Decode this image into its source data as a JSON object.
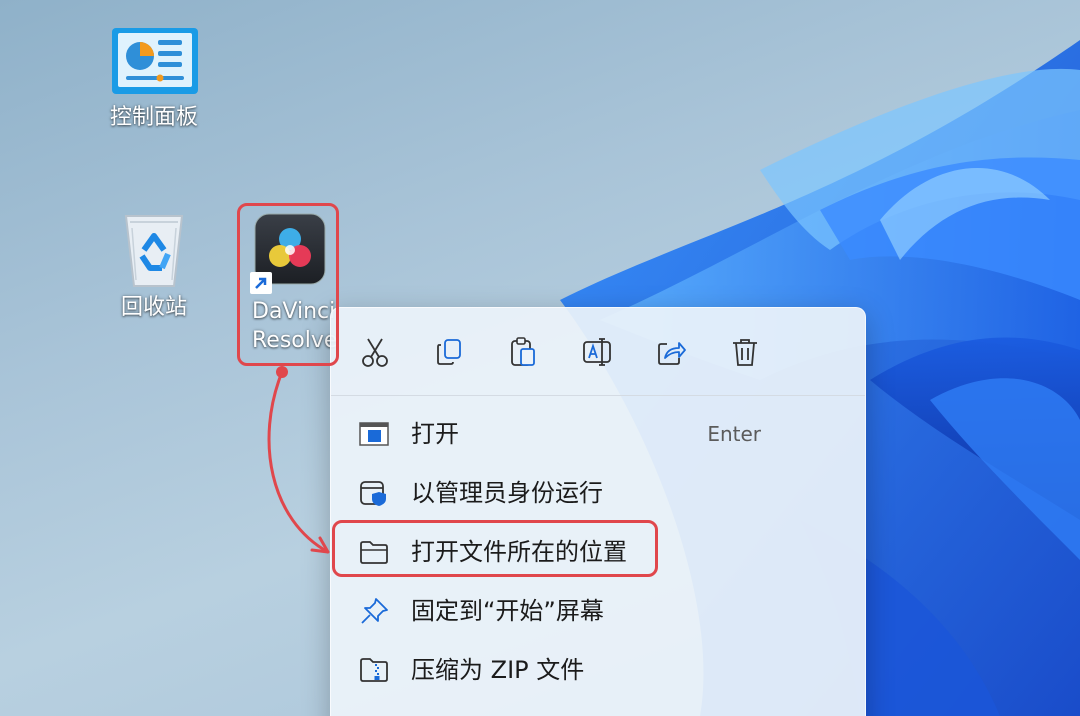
{
  "desktop": {
    "icons": [
      {
        "label": "控制面板",
        "icon": "control-panel-icon"
      },
      {
        "label": "回收站",
        "icon": "recycle-bin-icon"
      },
      {
        "label_line1": "DaVinci",
        "label_line2": "Resolve",
        "icon": "davinci-resolve-icon",
        "shortcut_icon": "shortcut-arrow-icon"
      }
    ]
  },
  "context_menu": {
    "toolbar": [
      {
        "icon": "cut-icon"
      },
      {
        "icon": "copy-icon"
      },
      {
        "icon": "paste-icon"
      },
      {
        "icon": "rename-icon"
      },
      {
        "icon": "share-icon"
      },
      {
        "icon": "delete-icon"
      }
    ],
    "items": [
      {
        "label": "打开",
        "shortcut": "Enter",
        "icon": "open-icon"
      },
      {
        "label": "以管理员身份运行",
        "icon": "run-as-admin-icon"
      },
      {
        "label": "打开文件所在的位置",
        "icon": "folder-icon"
      },
      {
        "label": "固定到“开始”屏幕",
        "icon": "pin-icon"
      },
      {
        "label": "压缩为 ZIP 文件",
        "icon": "zip-folder-icon"
      }
    ]
  },
  "annotation": {
    "color": "#e0474c"
  }
}
